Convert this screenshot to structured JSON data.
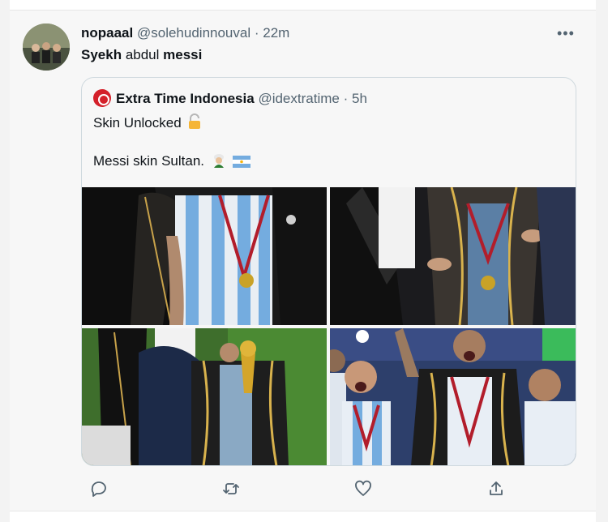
{
  "tweet": {
    "author_name": "nopaaal",
    "author_handle": "@solehudinnouval",
    "time": "22m",
    "separator": "·",
    "more_label": "•••",
    "text_part1": "Syekh",
    "text_part2": " abdul ",
    "text_part3": "messi"
  },
  "quote": {
    "author_name": "Extra Time Indonesia",
    "author_handle": "@idextratime",
    "time": "5h",
    "separator": "·",
    "line1": "Skin Unlocked",
    "line2": "Messi skin Sultan.",
    "emoji1": "padlock-icon",
    "emoji2": "person-with-turban-icon",
    "emoji3": "argentina-flag-icon"
  },
  "actions": {
    "icons": [
      "reply-icon",
      "retweet-icon",
      "like-icon",
      "share-icon"
    ]
  },
  "colors": {
    "text": "#0f1419",
    "meta": "#536471",
    "border": "#cfd9de",
    "background": "#f7f7f7"
  }
}
